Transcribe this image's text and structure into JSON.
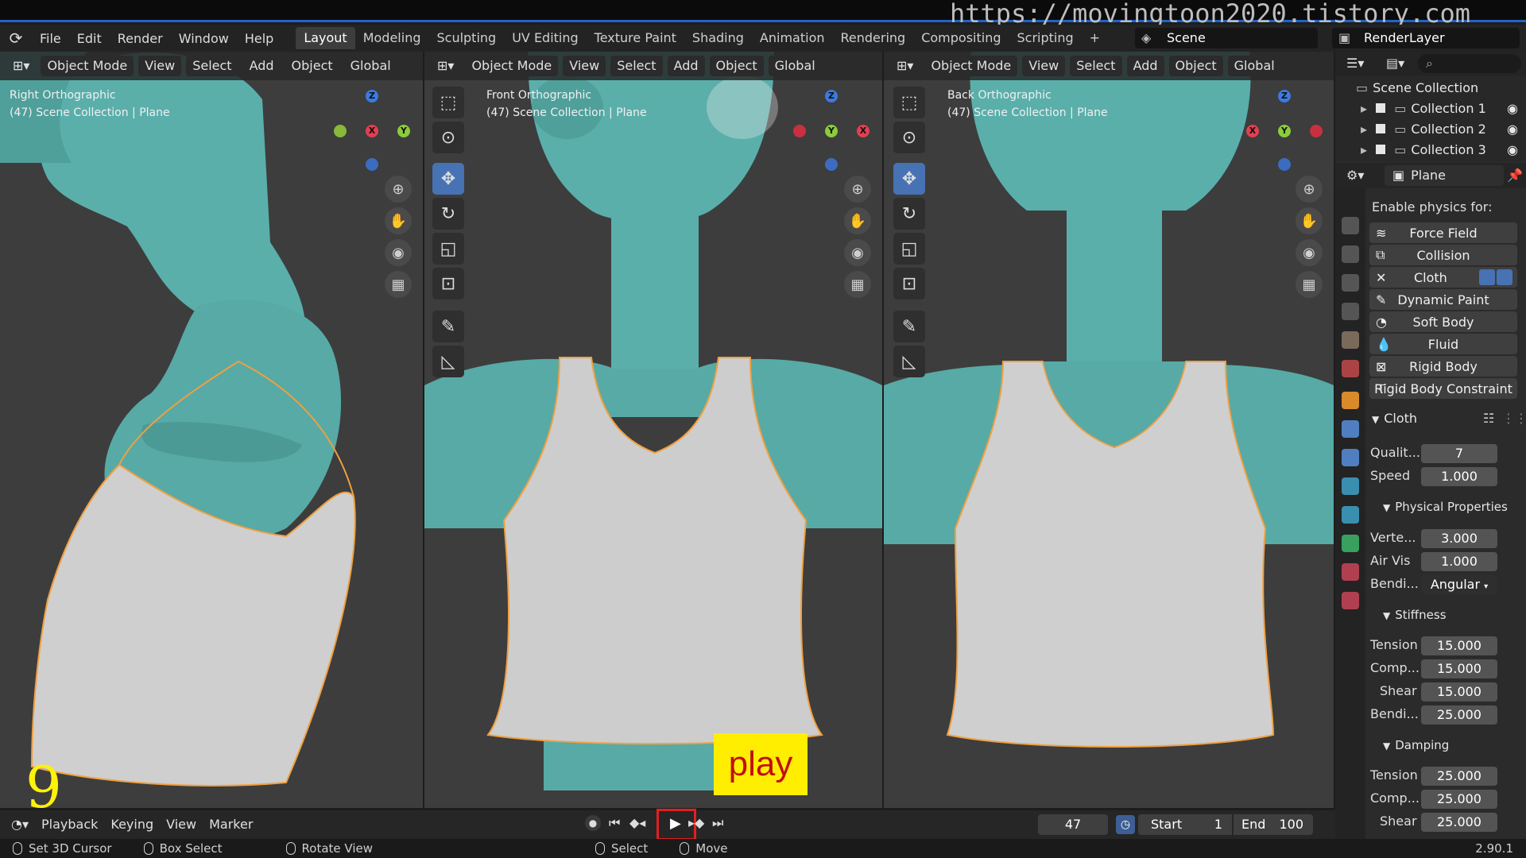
{
  "watermark": "https://movingtoon2020.tistory.com",
  "menus": [
    "File",
    "Edit",
    "Render",
    "Window",
    "Help"
  ],
  "workspaces": [
    "Layout",
    "Modeling",
    "Sculpting",
    "UV Editing",
    "Texture Paint",
    "Shading",
    "Animation",
    "Rendering",
    "Compositing",
    "Scripting"
  ],
  "scene_label": "Scene",
  "render_layer_label": "RenderLayer",
  "viewport_header": {
    "mode": "Object Mode",
    "view": "View",
    "select": "Select",
    "add": "Add",
    "object": "Object",
    "orientation": "Global"
  },
  "viewports": [
    {
      "title": "Right Orthographic",
      "subtitle": "(47) Scene Collection | Plane"
    },
    {
      "title": "Front Orthographic",
      "subtitle": "(47) Scene Collection | Plane"
    },
    {
      "title": "Back Orthographic",
      "subtitle": "(47) Scene Collection | Plane"
    }
  ],
  "overlay_step_number": "9",
  "overlay_play_label": "play",
  "timeline": {
    "playback": "Playback",
    "keying": "Keying",
    "view": "View",
    "marker": "Marker",
    "current_frame": "47",
    "start_label": "Start",
    "start_value": "1",
    "end_label": "End",
    "end_value": "100"
  },
  "statusbar": {
    "set_cursor": "Set 3D Cursor",
    "box_select": "Box Select",
    "rotate_view": "Rotate View",
    "select": "Select",
    "move": "Move",
    "version": "2.90.1"
  },
  "outliner": {
    "root": "Scene Collection",
    "collections": [
      "Collection 1",
      "Collection 2",
      "Collection 3"
    ]
  },
  "properties": {
    "object_name": "Plane",
    "physics_heading": "Enable physics for:",
    "physics_buttons": [
      "Force Field",
      "Collision",
      "Cloth",
      "Dynamic Paint",
      "Soft Body",
      "Fluid",
      "Rigid Body",
      "Rigid Body Constraint"
    ],
    "cloth_section": "Cloth",
    "quality_label": "Qualit...",
    "quality_value": "7",
    "speed_label": "Speed",
    "speed_value": "1.000",
    "physical_props_section": "Physical Properties",
    "vertex_label": "Verte...",
    "vertex_value": "3.000",
    "airvis_label": "Air Vis",
    "airvis_value": "1.000",
    "bending_label": "Bendi...",
    "bending_value": "Angular",
    "stiffness_section": "Stiffness",
    "stiff_tension_label": "Tension",
    "stiff_tension_value": "15.000",
    "stiff_comp_label": "Comp...",
    "stiff_comp_value": "15.000",
    "stiff_shear_label": "Shear",
    "stiff_shear_value": "15.000",
    "stiff_bend_label": "Bendi...",
    "stiff_bend_value": "25.000",
    "damping_section": "Damping",
    "damp_tension_label": "Tension",
    "damp_tension_value": "25.000",
    "damp_comp_label": "Comp...",
    "damp_comp_value": "25.000",
    "damp_shear_label": "Shear",
    "damp_shear_value": "25.000"
  },
  "colors": {
    "accent": "#4772b3",
    "body_teal": "#5fb5b0",
    "cloth_gray": "#c9c9c9",
    "selection_orange": "#f0a040",
    "overlay_yellow": "#ffee00",
    "highlight_red": "#e02020"
  }
}
